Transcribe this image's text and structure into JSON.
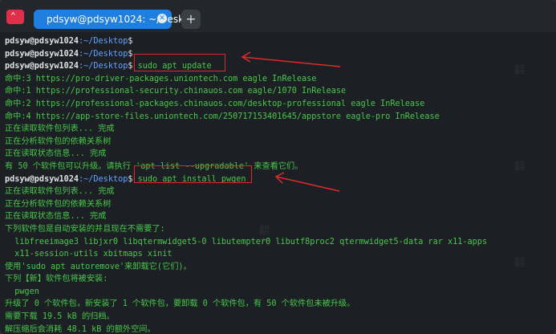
{
  "window": {
    "tab_title": "pdsyw@pdsyw1024: ~/Desktop",
    "app_icon_glyph": "⌃",
    "new_tab_glyph": "+",
    "close_glyph": "✕"
  },
  "prompt": {
    "user": "pdsyw@pdsyw1024",
    "path": ":~/Desktop",
    "sign": "$"
  },
  "lines": [
    {
      "type": "prompt",
      "cmd": ""
    },
    {
      "type": "prompt",
      "cmd": ""
    },
    {
      "type": "prompt",
      "cmd": " sudo apt update"
    },
    {
      "type": "out",
      "text": "命中:3 https://pro-driver-packages.uniontech.com eagle InRelease"
    },
    {
      "type": "out",
      "text": "命中:1 https://professional-security.chinauos.com eagle/1070 InRelease"
    },
    {
      "type": "out",
      "text": "命中:2 https://professional-packages.chinauos.com/desktop-professional eagle InRelease"
    },
    {
      "type": "out",
      "text": "命中:4 https://app-store-files.uniontech.com/250717153401645/appstore eagle-pro InRelease"
    },
    {
      "type": "out",
      "text": "正在读取软件包列表... 完成"
    },
    {
      "type": "out",
      "text": "正在分析软件包的依赖关系树"
    },
    {
      "type": "out",
      "text": "正在读取状态信息... 完成"
    },
    {
      "type": "out",
      "text": "有 50 个软件包可以升级。请执行 'apt list --upgradable' 来查看它们。"
    },
    {
      "type": "prompt",
      "cmd": " sudo apt install pwgen"
    },
    {
      "type": "out",
      "text": "正在读取软件包列表... 完成"
    },
    {
      "type": "out",
      "text": "正在分析软件包的依赖关系树"
    },
    {
      "type": "out",
      "text": "正在读取状态信息... 完成"
    },
    {
      "type": "out",
      "text": "下列软件包是自动安装的并且现在不需要了:"
    },
    {
      "type": "out",
      "text": "  libfreeimage3 libjxr0 libqtermwidget5-0 libutempter0 libutf8proc2 qtermwidget5-data rar x11-apps"
    },
    {
      "type": "out",
      "text": "  x11-session-utils xbitmaps xinit"
    },
    {
      "type": "out",
      "text": "使用'sudo apt autoremove'来卸载它(它们)。"
    },
    {
      "type": "out",
      "text": "下列【新】软件包将被安装:"
    },
    {
      "type": "out",
      "text": "  pwgen"
    },
    {
      "type": "out",
      "text": "升级了 0 个软件包，新安装了 1 个软件包，要卸载 0 个软件包，有 50 个软件包未被升级。"
    },
    {
      "type": "out",
      "text": "需要下载 19.5 kB 的归档。"
    },
    {
      "type": "out",
      "text": "解压缩后会消耗 48.1 kB 的额外空间。"
    }
  ],
  "colors": {
    "annotation": "#e02a2a",
    "output": "#47c94a",
    "path": "#5fa3ff",
    "tab": "#1f7fe0"
  }
}
